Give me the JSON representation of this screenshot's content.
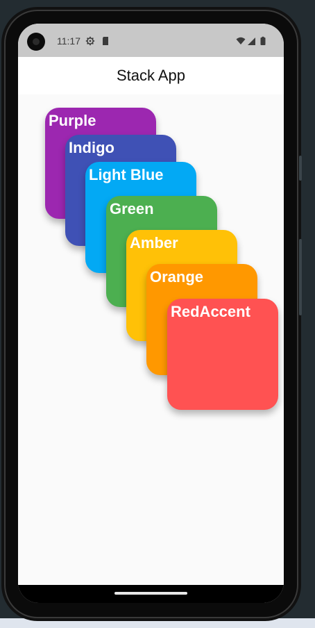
{
  "status_bar": {
    "time": "11:17",
    "icons_left": [
      "settings-gear-icon",
      "sd-card-icon"
    ],
    "icons_right": [
      "wifi-icon",
      "cellular-signal-icon",
      "battery-icon"
    ]
  },
  "app_bar": {
    "title": "Stack App"
  },
  "cards": [
    {
      "label": "Purple",
      "color": "#9c27b0"
    },
    {
      "label": "Indigo",
      "color": "#3f51b5"
    },
    {
      "label": "Light Blue",
      "color": "#03a9f4"
    },
    {
      "label": "Green",
      "color": "#4caf50"
    },
    {
      "label": "Amber",
      "color": "#ffc107"
    },
    {
      "label": "Orange",
      "color": "#ff9800"
    },
    {
      "label": "RedAccent",
      "color": "#ff5252"
    }
  ]
}
